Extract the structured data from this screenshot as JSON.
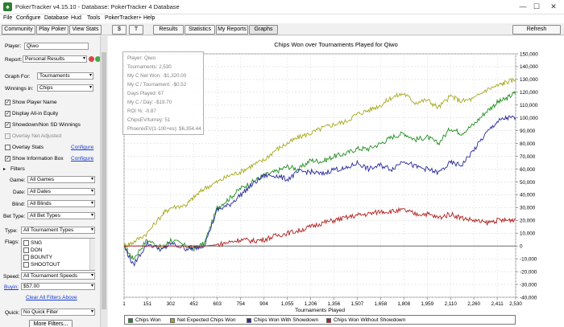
{
  "window": {
    "title": "PokerTracker v4.15.10 - Database: PokerTracker 4 Database",
    "minimize": "—",
    "maximize": "☐",
    "close": "✕"
  },
  "menu": [
    "File",
    "Configure",
    "Database",
    "Hud",
    "Tools",
    "PokerTracker+",
    "Help"
  ],
  "toolbar": {
    "community": "Community",
    "play_poker": "Play Poker",
    "view_stats": "View Stats",
    "dollar": "$",
    "t": "T",
    "results": "Results",
    "statistics": "Statistics",
    "my_reports": "My Reports",
    "graphs": "Graphs",
    "refresh": "Refresh"
  },
  "left": {
    "player_label": "Player:",
    "player_value": "Qiwo",
    "report_label": "Report:",
    "report_value": "Personal Results",
    "graph_for_label": "Graph For:",
    "graph_for_value": "Tournaments",
    "winnings_label": "Winnings in:",
    "winnings_value": "Chips",
    "checkboxes": [
      {
        "label": "Show Player Name",
        "checked": true,
        "disabled": false
      },
      {
        "label": "Display All-in Equity",
        "checked": true,
        "disabled": false
      },
      {
        "label": "Showdown/Non SD Winnings",
        "checked": true,
        "disabled": false
      },
      {
        "label": "Overlay Net Adjusted",
        "checked": false,
        "disabled": true
      },
      {
        "label": "Overlay Stats",
        "checked": false,
        "disabled": false
      },
      {
        "label": "Show Information Box",
        "checked": true,
        "disabled": false
      }
    ],
    "configure": "Configure",
    "filters_header": "Filters",
    "game_label": "Game:",
    "game_value": "All Games",
    "date_label": "Date:",
    "date_value": "All Dates",
    "blind_label": "Blind:",
    "blind_value": "All Blinds",
    "bettype_label": "Bet Type:",
    "bettype_value": "All Bet Types",
    "type_label": "Type:",
    "type_value": "All Tournament Types",
    "flags_label": "Flags:",
    "flags": [
      "SNG",
      "DON",
      "BOUNTY",
      "SHOOTOUT"
    ],
    "speed_label": "Speed:",
    "speed_value": "All Tournament Speeds",
    "buyin_label": "Buyin:",
    "buyin_value": "$57.00",
    "clear_filters": "Clear All Filters Above",
    "quick_label": "Quick:",
    "quick_value": "No Quick Filter",
    "more_filters": "More Filters..."
  },
  "info_box": [
    "Player: Qiwo",
    "Tournaments: 2,530",
    "My C Net Won: -$1,320.00",
    "My C / Tournament: -$0.52",
    "Days Played: 67",
    "My C / Day: -$19.70",
    "ROI %: -0.87",
    "ChipsEV/turney: 51",
    "PhoenixEV(1-100+es): $6,354.44"
  ],
  "colors": {
    "chips_won": "#1e8f1e",
    "net_expected": "#a8a820",
    "with_showdown": "#2a2a9a",
    "without_showdown": "#b02020"
  },
  "chart_data": {
    "type": "line",
    "title": "Chips Won over Tournaments Played for  Qiwo",
    "xlabel": "Tournaments Played",
    "ylabel": "",
    "x_ticks": [
      "1",
      "151",
      "302",
      "452",
      "603",
      "754",
      "904",
      "1,055",
      "1,206",
      "1,356",
      "1,507",
      "1,658",
      "1,808",
      "1,959",
      "2,110",
      "2,260",
      "2,411",
      "2,530"
    ],
    "y_ticks": [
      "150,000",
      "140,000",
      "130,000",
      "120,000",
      "110,000",
      "100,000",
      "90,000",
      "80,000",
      "70,000",
      "60,000",
      "50,000",
      "40,000",
      "30,000",
      "20,000",
      "10,000",
      "0",
      "-10,000",
      "-20,000",
      "-30,000",
      "-40,000"
    ],
    "xlim": [
      1,
      2530
    ],
    "ylim": [
      -40000,
      150000
    ],
    "series": [
      {
        "name": "Chips Won",
        "color_key": "chips_won",
        "x": [
          1,
          60,
          150,
          250,
          302,
          400,
          452,
          520,
          603,
          680,
          754,
          830,
          904,
          980,
          1055,
          1130,
          1206,
          1280,
          1356,
          1430,
          1507,
          1580,
          1658,
          1730,
          1808,
          1880,
          1959,
          2030,
          2110,
          2180,
          2260,
          2340,
          2411,
          2470,
          2530
        ],
        "y": [
          0,
          -10000,
          5000,
          -2000,
          5000,
          0,
          -2000,
          2000,
          30000,
          37000,
          45000,
          50000,
          55000,
          58000,
          62000,
          60000,
          67000,
          66000,
          70000,
          72000,
          76000,
          76000,
          80000,
          85000,
          88000,
          83000,
          85000,
          80000,
          92000,
          88000,
          95000,
          105000,
          112000,
          115000,
          120000
        ]
      },
      {
        "name": "Net Expected Chips Won",
        "color_key": "net_expected",
        "x": [
          1,
          60,
          150,
          250,
          302,
          400,
          452,
          520,
          603,
          680,
          754,
          830,
          904,
          980,
          1055,
          1130,
          1206,
          1280,
          1356,
          1430,
          1507,
          1580,
          1658,
          1730,
          1808,
          1880,
          1959,
          2030,
          2110,
          2180,
          2260,
          2340,
          2411,
          2470,
          2530
        ],
        "y": [
          0,
          3000,
          10000,
          25000,
          30000,
          32000,
          38000,
          45000,
          50000,
          55000,
          58000,
          63000,
          67000,
          75000,
          80000,
          85000,
          88000,
          92000,
          95000,
          97000,
          103000,
          106000,
          110000,
          116000,
          119000,
          112000,
          114000,
          108000,
          117000,
          113000,
          115000,
          122000,
          125000,
          128000,
          130000
        ]
      },
      {
        "name": "Chips Won With Showdown",
        "color_key": "with_showdown",
        "x": [
          1,
          60,
          150,
          250,
          302,
          400,
          452,
          520,
          603,
          680,
          754,
          830,
          904,
          980,
          1055,
          1130,
          1206,
          1280,
          1356,
          1430,
          1507,
          1580,
          1658,
          1730,
          1808,
          1880,
          1959,
          2030,
          2110,
          2180,
          2260,
          2340,
          2411,
          2470,
          2530
        ],
        "y": [
          0,
          -15000,
          2000,
          -3000,
          2000,
          -2000,
          -2000,
          1000,
          28000,
          32000,
          40000,
          48000,
          55000,
          55000,
          52000,
          58000,
          58000,
          56000,
          60000,
          60000,
          65000,
          60000,
          63000,
          60000,
          67000,
          62000,
          60000,
          57000,
          65000,
          63000,
          75000,
          88000,
          97000,
          100000,
          100000
        ]
      },
      {
        "name": "Chips Won Without Showdown",
        "color_key": "without_showdown",
        "x": [
          1,
          60,
          150,
          250,
          302,
          400,
          452,
          520,
          603,
          680,
          754,
          830,
          904,
          980,
          1055,
          1130,
          1206,
          1280,
          1356,
          1430,
          1507,
          1580,
          1658,
          1730,
          1808,
          1880,
          1959,
          2030,
          2110,
          2180,
          2260,
          2340,
          2411,
          2470,
          2530
        ],
        "y": [
          0,
          0,
          0,
          0,
          0,
          0,
          0,
          0,
          1000,
          3000,
          5000,
          4000,
          5000,
          8000,
          10000,
          12000,
          15000,
          18000,
          20000,
          22000,
          24000,
          25000,
          27000,
          27000,
          28000,
          25000,
          25000,
          22000,
          25000,
          22000,
          20000,
          18000,
          20000,
          20000,
          21000
        ]
      }
    ],
    "grid": true,
    "legend": "bottom"
  }
}
